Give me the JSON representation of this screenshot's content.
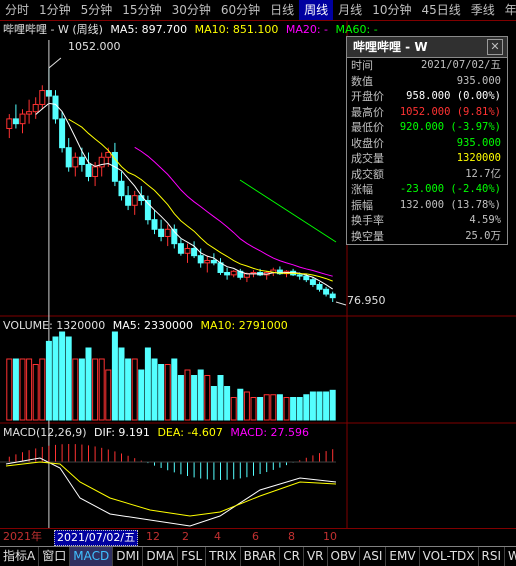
{
  "tabs": [
    "分时",
    "1分钟",
    "5分钟",
    "15分钟",
    "30分钟",
    "60分钟",
    "日线",
    "周线",
    "月线",
    "10分钟",
    "45日线",
    "季线",
    "年"
  ],
  "active_tab": "周线",
  "colors": {
    "up": "#ff3232",
    "down": "#54ffff",
    "ma5": "#ffffff",
    "ma10": "#ffff00",
    "ma20": "#ff00ff",
    "ma60": "#00ff00",
    "panel_border": "#800000",
    "dif": "#ffffff",
    "dea": "#ffff00"
  },
  "main_legend": {
    "name": "哔哩哔哩 - W (周线)",
    "ma5": "MA5: 897.700",
    "ma10": "MA10: 851.100",
    "ma20": "MA20: -",
    "ma60": "MA60: -"
  },
  "annotations": {
    "high": "1052.000",
    "low": "76.950"
  },
  "info_panel": {
    "title": "哔哩哔哩 - W",
    "close_label": "✕",
    "rows": [
      {
        "label": "时间",
        "value": "2021/07/02/五",
        "color": "#c0c0c0"
      },
      {
        "label": "数值",
        "value": "935.000",
        "color": "#c0c0c0"
      },
      {
        "label": "开盘价",
        "value": "958.000 (0.00%)",
        "color": "#ffffff"
      },
      {
        "label": "最高价",
        "value": "1052.000 (9.81%)",
        "color": "#ff3232"
      },
      {
        "label": "最低价",
        "value": "920.000 (-3.97%)",
        "color": "#00ff00"
      },
      {
        "label": "收盘价",
        "value": "935.000",
        "color": "#00ff00"
      },
      {
        "label": "成交量",
        "value": "1320000",
        "color": "#ffff00"
      },
      {
        "label": "成交额",
        "value": "12.7亿",
        "color": "#c0c0c0"
      },
      {
        "label": "涨幅",
        "value": "-23.000 (-2.40%)",
        "color": "#00ff00"
      },
      {
        "label": "振幅",
        "value": "132.000 (13.78%)",
        "color": "#c0c0c0"
      },
      {
        "label": "换手率",
        "value": "4.59%",
        "color": "#c0c0c0"
      },
      {
        "label": "换空量",
        "value": "25.0万",
        "color": "#c0c0c0"
      }
    ]
  },
  "volume_legend": {
    "name": "VOLUME: 1320000",
    "ma5": "MA5: 2330000",
    "ma10": "MA10: 2791000"
  },
  "macd_legend": {
    "name": "MACD(12,26,9)",
    "dif": "DIF: 9.191",
    "dea": "DEA: -4.607",
    "macd": "MACD: 27.596"
  },
  "x_labels": {
    "year": "2021年",
    "selected": "2021/07/02/五",
    "m12": "12",
    "m2": "2",
    "m4": "4",
    "m6": "6",
    "m8": "8",
    "m10": "10"
  },
  "bottom_tabs": [
    "指标A",
    "窗口",
    "MACD",
    "DMI",
    "DMA",
    "FSL",
    "TRIX",
    "BRAR",
    "CR",
    "VR",
    "OBV",
    "ASI",
    "EMV",
    "VOL-TDX",
    "RSI",
    "W"
  ],
  "active_bottom_tab": "MACD",
  "chart_data": {
    "type": "candlestick",
    "interval": "weekly",
    "ylim": [
      76.95,
      1052.0
    ],
    "ohlc_approx": [
      [
        800,
        860,
        760,
        840
      ],
      [
        840,
        900,
        800,
        820
      ],
      [
        820,
        880,
        780,
        860
      ],
      [
        860,
        920,
        820,
        870
      ],
      [
        870,
        930,
        840,
        900
      ],
      [
        900,
        980,
        880,
        958
      ],
      [
        958,
        1052,
        920,
        935
      ],
      [
        935,
        960,
        820,
        840
      ],
      [
        840,
        870,
        700,
        720
      ],
      [
        720,
        760,
        620,
        640
      ],
      [
        640,
        700,
        600,
        680
      ],
      [
        680,
        720,
        620,
        650
      ],
      [
        650,
        700,
        580,
        600
      ],
      [
        600,
        660,
        560,
        640
      ],
      [
        640,
        700,
        600,
        680
      ],
      [
        680,
        720,
        640,
        700
      ],
      [
        700,
        740,
        560,
        580
      ],
      [
        580,
        620,
        500,
        520
      ],
      [
        520,
        560,
        460,
        480
      ],
      [
        480,
        540,
        440,
        520
      ],
      [
        520,
        560,
        480,
        500
      ],
      [
        500,
        520,
        400,
        420
      ],
      [
        420,
        460,
        360,
        380
      ],
      [
        380,
        420,
        330,
        350
      ],
      [
        350,
        400,
        310,
        380
      ],
      [
        380,
        400,
        300,
        320
      ],
      [
        320,
        340,
        270,
        280
      ],
      [
        280,
        320,
        240,
        300
      ],
      [
        300,
        330,
        260,
        270
      ],
      [
        270,
        300,
        220,
        240
      ],
      [
        240,
        270,
        200,
        250
      ],
      [
        250,
        280,
        230,
        240
      ],
      [
        240,
        260,
        190,
        200
      ],
      [
        200,
        220,
        170,
        190
      ],
      [
        190,
        210,
        180,
        205
      ],
      [
        205,
        215,
        170,
        180
      ],
      [
        180,
        200,
        160,
        195
      ],
      [
        195,
        210,
        180,
        200
      ],
      [
        200,
        215,
        185,
        190
      ],
      [
        190,
        205,
        170,
        200
      ],
      [
        200,
        220,
        185,
        210
      ],
      [
        210,
        225,
        190,
        195
      ],
      [
        195,
        210,
        180,
        205
      ],
      [
        205,
        215,
        185,
        190
      ],
      [
        190,
        200,
        170,
        185
      ],
      [
        185,
        195,
        160,
        170
      ],
      [
        170,
        180,
        140,
        150
      ],
      [
        150,
        160,
        120,
        130
      ],
      [
        130,
        140,
        100,
        110
      ],
      [
        110,
        120,
        76.95,
        95
      ]
    ],
    "volume_latest": 1320000,
    "volume_ma5": 2330000,
    "volume_ma10": 2791000,
    "macd": {
      "dif": 9.191,
      "dea": -4.607,
      "macd": 27.596
    }
  }
}
